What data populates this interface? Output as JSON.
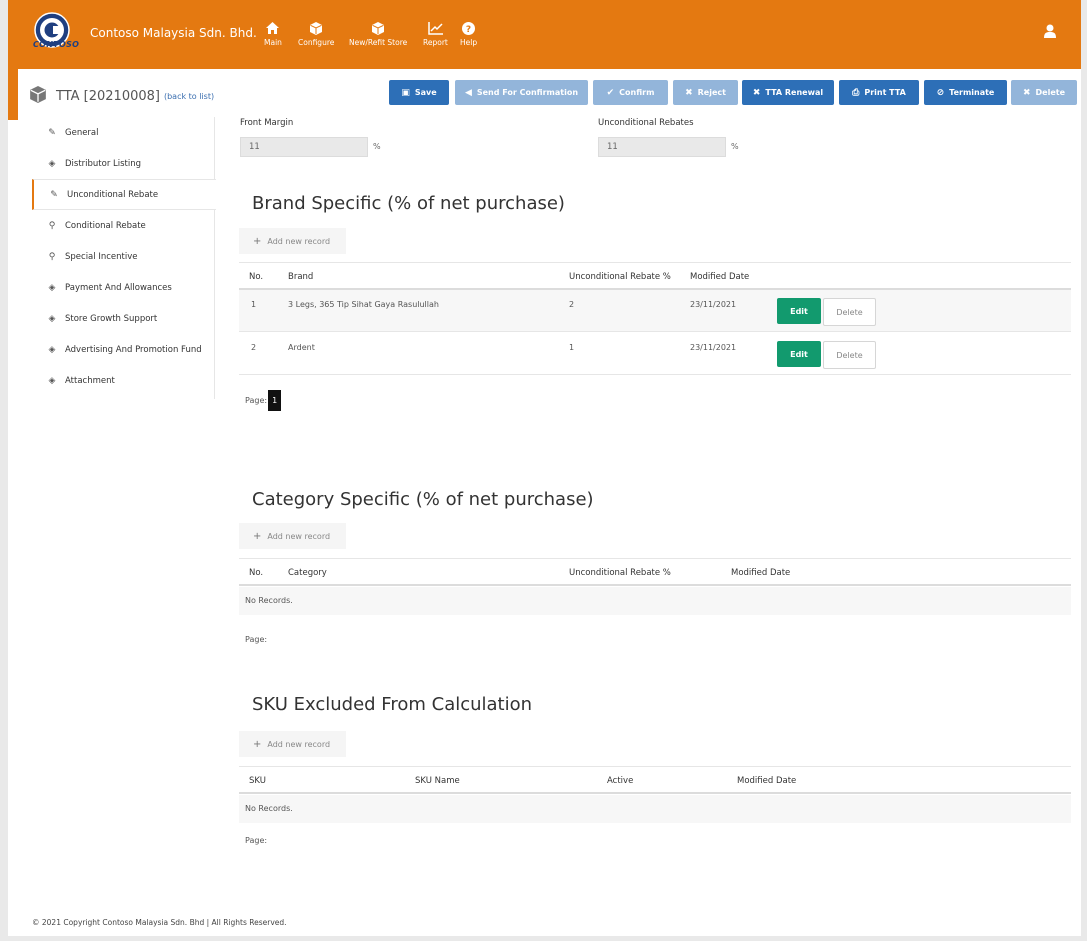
{
  "header": {
    "company": "Contoso Malaysia Sdn. Bhd.",
    "logo_text": "CONTOSO",
    "nav": [
      {
        "label": "Main",
        "icon": "home-icon"
      },
      {
        "label": "Configure",
        "icon": "cube-icon"
      },
      {
        "label": "New/Refit Store",
        "icon": "cube-icon"
      },
      {
        "label": "Report",
        "icon": "chart-icon"
      },
      {
        "label": "Help",
        "icon": "help-icon"
      }
    ],
    "user_icon": "user-icon"
  },
  "page": {
    "title": "TTA [20210008]",
    "back_link": "(back to list)"
  },
  "toolbar": {
    "save": "Save",
    "send_for_confirmation": "Send For Confirmation",
    "confirm": "Confirm",
    "reject": "Reject",
    "tta_renewal": "TTA Renewal",
    "print_tta": "Print TTA",
    "terminate": "Terminate",
    "delete": "Delete"
  },
  "sidebar": {
    "items": [
      {
        "label": "General",
        "icon": "pencil-icon"
      },
      {
        "label": "Distributor Listing",
        "icon": "cube-icon"
      },
      {
        "label": "Unconditional Rebate",
        "icon": "pencil-icon"
      },
      {
        "label": "Conditional Rebate",
        "icon": "search-icon"
      },
      {
        "label": "Special Incentive",
        "icon": "search-icon"
      },
      {
        "label": "Payment And Allowances",
        "icon": "cube-icon"
      },
      {
        "label": "Store Growth Support",
        "icon": "cube-icon"
      },
      {
        "label": "Advertising And Promotion Fund",
        "icon": "cube-icon"
      },
      {
        "label": "Attachment",
        "icon": "cube-icon"
      }
    ],
    "active": "Unconditional Rebate"
  },
  "fields": {
    "front_margin": {
      "label": "Front Margin",
      "value": "11",
      "unit": "%"
    },
    "unconditional_rebates": {
      "label": "Unconditional Rebates",
      "value": "11",
      "unit": "%"
    }
  },
  "brand_section": {
    "title": "Brand Specific (% of net purchase)",
    "add_label": "Add new record",
    "headers": {
      "no": "No.",
      "brand": "Brand",
      "rebate": "Unconditional Rebate %",
      "modified": "Modified Date"
    },
    "rows": [
      {
        "no": "1",
        "brand": "3 Legs, 365 Tip Sihat Gaya Rasulullah",
        "rebate": "2",
        "modified": "23/11/2021"
      },
      {
        "no": "2",
        "brand": "Ardent",
        "rebate": "1",
        "modified": "23/11/2021"
      }
    ],
    "edit_label": "Edit",
    "delete_label": "Delete",
    "page_label": "Page:",
    "page_current": "1"
  },
  "category_section": {
    "title": "Category Specific (% of net purchase)",
    "add_label": "Add new record",
    "headers": {
      "no": "No.",
      "category": "Category",
      "rebate": "Unconditional Rebate %",
      "modified": "Modified Date"
    },
    "empty": "No Records.",
    "page_label": "Page:"
  },
  "sku_section": {
    "title": "SKU Excluded From Calculation",
    "add_label": "Add new record",
    "headers": {
      "sku": "SKU",
      "sku_name": "SKU Name",
      "active": "Active",
      "modified": "Modified Date"
    },
    "empty": "No Records.",
    "page_label": "Page:"
  },
  "footer": {
    "text": "© 2021 Copyright Contoso Malaysia Sdn. Bhd | All Rights Reserved."
  },
  "colors": {
    "brand_orange": "#e47911",
    "primary_blue": "#2d6fb7",
    "disabled_blue": "#93b5da",
    "edit_green": "#129a6e"
  }
}
